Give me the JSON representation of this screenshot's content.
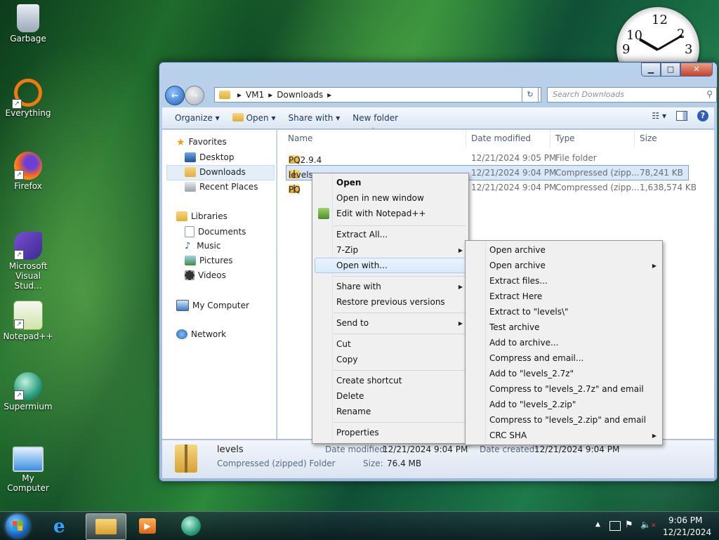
{
  "desktop": {
    "icons": [
      {
        "label": "Garbage"
      },
      {
        "label": "Everything"
      },
      {
        "label": "Firefox"
      },
      {
        "label": "Microsoft Visual Stud..."
      },
      {
        "label": "Notepad++"
      },
      {
        "label": "Supermium"
      },
      {
        "label": "My Computer"
      }
    ]
  },
  "clock": {
    "numerals": [
      "12",
      "2",
      "3",
      "10",
      "9"
    ]
  },
  "window": {
    "caption": {
      "minimize": "▁",
      "maximize": "□",
      "close": "✕"
    },
    "address": {
      "root_glyph": "▸",
      "segments": [
        "VM1",
        "Downloads"
      ],
      "refresh_glyph": "↻"
    },
    "search": {
      "placeholder": "Search Downloads"
    },
    "toolbar": {
      "organize": "Organize ▾",
      "open": "Open ▾",
      "share_with": "Share with ▾",
      "new_folder": "New folder"
    },
    "navpane": {
      "favorites": "Favorites",
      "desktop": "Desktop",
      "downloads": "Downloads",
      "recent_places": "Recent Places",
      "libraries": "Libraries",
      "documents": "Documents",
      "music": "Music",
      "pictures": "Pictures",
      "videos": "Videos",
      "my_computer": "My Computer",
      "network": "Network"
    },
    "columns": {
      "name": "Name",
      "date_modified": "Date modified",
      "type": "Type",
      "size": "Size"
    },
    "files": [
      {
        "name": "PQ2.9.4",
        "date": "12/21/2024 9:05 PM",
        "type": "File folder",
        "size": ""
      },
      {
        "name": "levels",
        "date": "12/21/2024 9:04 PM",
        "type": "Compressed (zipp...",
        "size": "78,241 KB"
      },
      {
        "name": "PQ",
        "date": "12/21/2024 9:04 PM",
        "type": "Compressed (zipp...",
        "size": "1,638,574 KB"
      }
    ],
    "details": {
      "name": "levels",
      "type": "Compressed (zipped) Folder",
      "date_modified_label": "Date modified:",
      "date_modified": "12/21/2024 9:04 PM",
      "size_label": "Size:",
      "size": "76.4 MB",
      "date_created_label": "Date created:",
      "date_created": "12/21/2024 9:04 PM"
    }
  },
  "context_menu": {
    "items": {
      "open": "Open",
      "open_new_window": "Open in new window",
      "edit_notepad": "Edit with Notepad++",
      "extract_all": "Extract All...",
      "seven_zip": "7-Zip",
      "open_with": "Open with...",
      "share_with": "Share with",
      "restore": "Restore previous versions",
      "send_to": "Send to",
      "cut": "Cut",
      "copy": "Copy",
      "create_shortcut": "Create shortcut",
      "delete": "Delete",
      "rename": "Rename",
      "properties": "Properties"
    },
    "arrow": "▶"
  },
  "submenu_7zip": {
    "items": [
      "Open archive",
      "Open archive",
      "Extract files...",
      "Extract Here",
      "Extract to \"levels\\\"",
      "Test archive",
      "Add to archive...",
      "Compress and email...",
      "Add to \"levels_2.7z\"",
      "Compress to \"levels_2.7z\" and email",
      "Add to \"levels_2.zip\"",
      "Compress to \"levels_2.zip\" and email",
      "CRC SHA"
    ]
  },
  "taskbar": {
    "time": "9:06 PM",
    "date": "12/21/2024",
    "tray_chevron": "▲"
  }
}
